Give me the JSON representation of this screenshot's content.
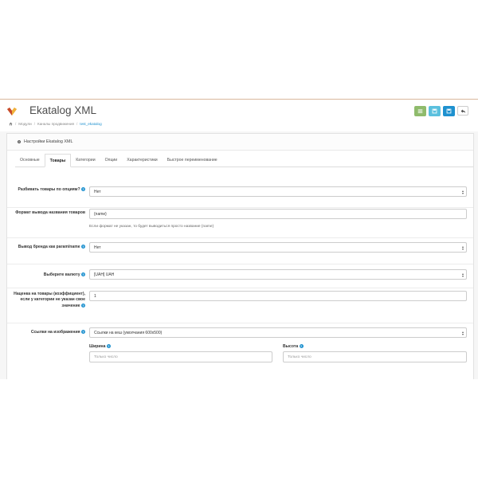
{
  "header": {
    "title": "Ekatalog XML",
    "breadcrumb": [
      "Модули",
      "Каналы продвижения",
      "test_ekatalog"
    ]
  },
  "panel": {
    "title": "Настройки Ekatalog XML"
  },
  "tabs": [
    {
      "label": "Основные",
      "active": false
    },
    {
      "label": "Товары",
      "active": true
    },
    {
      "label": "Категории",
      "active": false
    },
    {
      "label": "Опции",
      "active": false
    },
    {
      "label": "Характеристики",
      "active": false
    },
    {
      "label": "Быстрое переименование",
      "active": false
    }
  ],
  "form": {
    "split_by_options": {
      "label": "Разбивать товары по опциям?",
      "value": "Нет"
    },
    "name_format": {
      "label": "Формат вывода названия товаров",
      "value": "{name}",
      "hint": "Если формат не указан, то будет выводиться просто название {name}"
    },
    "brand_param": {
      "label": "Вывод бренда как param/name",
      "value": "Нет"
    },
    "currency": {
      "label": "Выберите валюту",
      "value": "[UAH] UAH"
    },
    "markup": {
      "label": "Наценка на товары (коэффициент), если у категории не указан свое значение",
      "value": "1"
    },
    "image_links": {
      "label": "Ссылки на изображения",
      "value": "Ссылки на кеш (умолчания 600х500)"
    },
    "width": {
      "label": "Ширина",
      "placeholder": "Только число"
    },
    "height": {
      "label": "Высота",
      "placeholder": "Только число"
    }
  },
  "colors": {
    "accent": "#1e91cf",
    "green": "#8fbb6c",
    "light_blue": "#5bc0de",
    "top_border": "#d9b79c"
  }
}
